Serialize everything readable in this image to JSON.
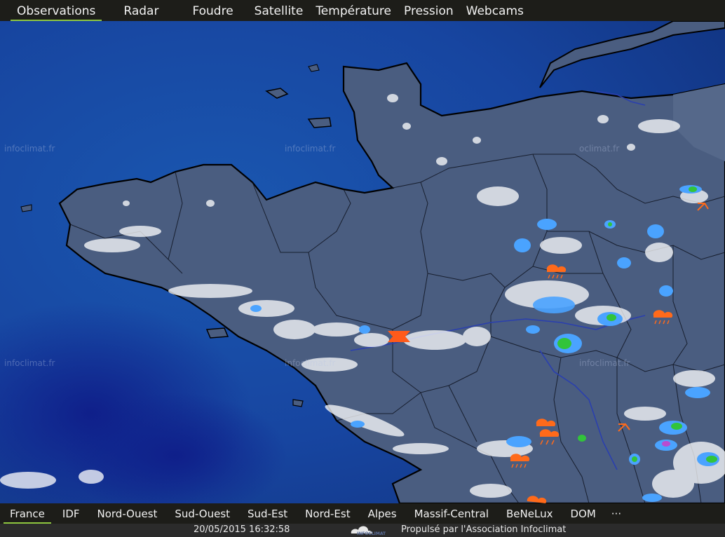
{
  "top_tabs": [
    {
      "label": "Observations",
      "active": true
    },
    {
      "label": "Radar"
    },
    {
      "label": "Foudre"
    },
    {
      "label": "Satellite"
    },
    {
      "label": "Température"
    },
    {
      "label": "Pression"
    },
    {
      "label": "Webcams"
    }
  ],
  "map": {
    "watermark": "infoclimat.fr",
    "watermark_partial": "oclimat.fr",
    "icons": [
      "rain-shower-icon",
      "thunderstorm-icon",
      "wind-direction-arrow-icon",
      "lightning-cross-icon"
    ]
  },
  "region_tabs": [
    {
      "label": "France",
      "active": true
    },
    {
      "label": "IDF"
    },
    {
      "label": "Nord-Ouest"
    },
    {
      "label": "Sud-Ouest"
    },
    {
      "label": "Sud-Est"
    },
    {
      "label": "Nord-Est"
    },
    {
      "label": "Alpes"
    },
    {
      "label": "Massif-Central"
    },
    {
      "label": "BeNeLux"
    },
    {
      "label": "DOM"
    },
    {
      "label": "···"
    }
  ],
  "footer": {
    "timestamp": "20/05/2015 16:32:58",
    "logo_text": "INFOCLIMAT",
    "credit": "Propulsé par l'Association Infoclimat"
  },
  "colors": {
    "accent": "#8ec63f",
    "sea": "#15408f",
    "land": "#4a5d80",
    "icon_orange": "#ff6a1a"
  }
}
